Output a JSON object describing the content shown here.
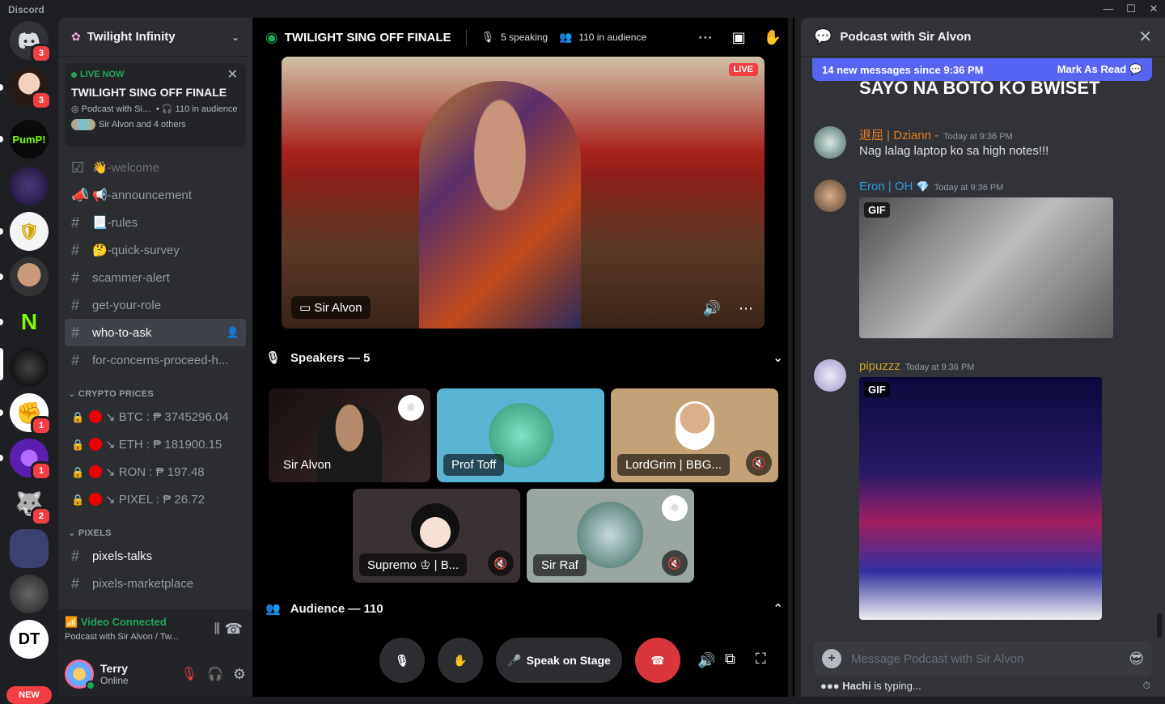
{
  "window": {
    "title": "Discord"
  },
  "server_rail": {
    "badges": [
      "3",
      "3",
      "1",
      "1",
      "2"
    ],
    "pump_label": "PumP!",
    "dt_label": "DT",
    "new_label": "NEW"
  },
  "sidebar": {
    "guild_name": "Twilight Infinity",
    "live": {
      "live_now": "LIVE NOW",
      "title": "TWILIGHT SING OFF FINALE",
      "host": "Podcast with Si…",
      "audience": "110 in audience",
      "speakers": "Sir Alvon and 4 others"
    },
    "channels": [
      {
        "label": "👋-welcome",
        "style": "faded"
      },
      {
        "label": "📢-announcement",
        "style": "normal"
      },
      {
        "label": "📃-rules",
        "style": "normal"
      },
      {
        "label": "🤔-quick-survey",
        "style": "normal"
      },
      {
        "label": "scammer-alert",
        "style": "normal"
      },
      {
        "label": "get-your-role",
        "style": "normal"
      },
      {
        "label": "who-to-ask",
        "style": "active"
      },
      {
        "label": "for-concerns-proceed-h...",
        "style": "normal"
      }
    ],
    "category_crypto": "CRYPTO PRICES",
    "crypto": [
      "↘ BTC : ₱ 3745296.04",
      "↘ ETH : ₱ 181900.15",
      "↘ RON : ₱ 197.48",
      "↘ PIXEL : ₱ 26.72"
    ],
    "category_pixels": "PIXELS",
    "pixels_channels": [
      "pixels-talks",
      "pixels-marketplace"
    ],
    "voice": {
      "status": "Video Connected",
      "channel": "Podcast with Sir Alvon / Tw..."
    },
    "user": {
      "name": "Terry",
      "status": "Online"
    }
  },
  "stage": {
    "title": "TWILIGHT SING OFF FINALE",
    "speaking": "5 speaking",
    "audience": "110 in audience",
    "live_tag": "LIVE",
    "main_speaker": "Sir Alvon",
    "speakers_header": "Speakers — 5",
    "tiles": [
      "Sir Alvon",
      "Prof Toff",
      "LordGrim | BBG...",
      "Supremo ♔ | B...",
      "Sir Raf"
    ],
    "audience_header": "Audience — 110",
    "speak_on_stage": "Speak on Stage"
  },
  "chat": {
    "title": "Podcast with Sir Alvon",
    "new_messages": "14 new messages since 9:36 PM",
    "mark_read": "Mark As Read",
    "prev_text": "SAYO NA BOTO KO BWISET",
    "messages": [
      {
        "author": "退屈 | Dziann -",
        "color": "#e67e22",
        "time": "Today at 9:36 PM",
        "text": "Nag lalag laptop ko sa high notes!!!"
      },
      {
        "author": "Eron | OH",
        "color": "#3498db",
        "time": "Today at 9:36 PM",
        "text": ""
      },
      {
        "author": "pipuzzz",
        "color": "#c9a227",
        "time": "Today at 9:36 PM",
        "text": ""
      }
    ],
    "gif_label": "GIF",
    "placeholder": "Message Podcast with Sir Alvon",
    "typing_user": "Hachi",
    "typing_text": " is typing..."
  },
  "colors": {
    "accent": "#5865f2",
    "green": "#23a55a",
    "danger": "#f23f43"
  }
}
